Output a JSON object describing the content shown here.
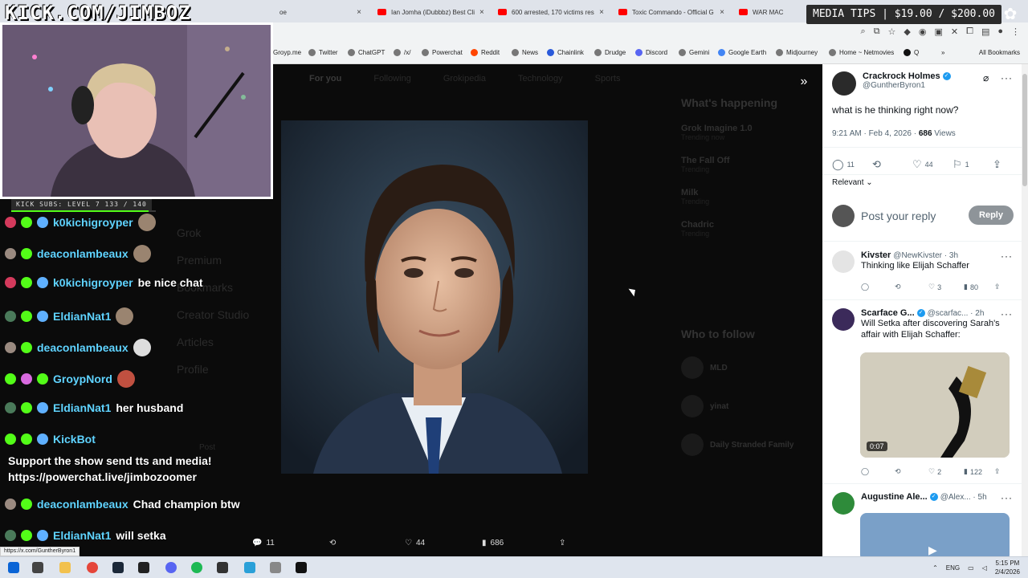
{
  "stream": {
    "channel_logo_text": "KICK.COM/JIMBOZ",
    "subs_label": "KICK SUBS: LEVEL 7 133 / 140",
    "subs_progress": 0.95,
    "media_tips": "MEDIA TIPS | $19.00 / $200.00"
  },
  "browser": {
    "tabs": [
      {
        "label": "oe"
      },
      {
        "label": "Ian Jomha (iDubbbz) Best Cli"
      },
      {
        "label": "600 arrested, 170 victims res"
      },
      {
        "label": "Toxic Commando - Official G"
      },
      {
        "label": "WAR MAC"
      }
    ],
    "bookmarks": [
      "Groyp.me",
      "Twitter",
      "ChatGPT",
      "/x/",
      "Powerchat",
      "Reddit",
      "News",
      "Chainlink",
      "Drudge",
      "Discord",
      "Gemini",
      "Google Earth",
      "Midjourney",
      "Home ~ Netmovies",
      "Q"
    ],
    "all_bookmarks": "All Bookmarks",
    "status_url": "https://x.com/GuntherByron1"
  },
  "x_page": {
    "nav_tabs": [
      "For you",
      "Following",
      "Grokipedia",
      "Technology",
      "Sports"
    ],
    "sidenav": [
      "Grok",
      "Premium",
      "Bookmarks",
      "Creator Studio",
      "Articles",
      "Profile"
    ],
    "post_button": "Post",
    "whats_happening": "What's happening",
    "trends": [
      {
        "title": "Grok Imagine 1.0",
        "sub": "Trending now"
      },
      {
        "title": "The Fall Off",
        "sub": "Trending"
      },
      {
        "title": "Milk",
        "sub": "Trending"
      },
      {
        "title": "Chadric",
        "sub": "Trending"
      }
    ],
    "who_to_follow": "Who to follow",
    "follow_suggestions": [
      "MLD",
      "yinat",
      "Daily Stranded Family"
    ]
  },
  "viewer": {
    "actions": {
      "replies": "11",
      "likes": "44",
      "views": "686"
    }
  },
  "post": {
    "name": "Crackrock Holmes",
    "handle": "@GuntherByron1",
    "text": "what is he thinking right now?",
    "time": "9:21 AM · Feb 4, 2026 · ",
    "views_count": "686",
    "views_label": " Views",
    "replies": "11",
    "likes": "44",
    "bookmarks": "1",
    "sort_label": "Relevant",
    "reply_placeholder": "Post your reply",
    "reply_button": "Reply"
  },
  "replies": [
    {
      "name": "Kivster",
      "handle": "@NewKivster · 3h",
      "text": "Thinking like Elijah Schaffer",
      "replies": "",
      "likes": "3",
      "views": "80",
      "verified": false
    },
    {
      "name": "Scarface G...",
      "handle": "@scarfac... · 2h",
      "text": "Will Setka after discovering Sarah's affair with Elijah Schaffer:",
      "replies": "",
      "likes": "2",
      "views": "122",
      "verified": true,
      "media_duration": "0:07"
    },
    {
      "name": "Augustine Ale...",
      "handle": "@Alex... · 5h",
      "text": "",
      "verified": true
    }
  ],
  "chat": [
    {
      "user": "k0kichigroyper",
      "text": "",
      "color": "#5fd3ff"
    },
    {
      "user": "deaconlambeaux",
      "text": "",
      "color": "#5fd3ff"
    },
    {
      "user": "k0kichigroyper",
      "text": "be nice chat",
      "color": "#5fd3ff"
    },
    {
      "user": "EldianNat1",
      "text": "",
      "color": "#5fd3ff"
    },
    {
      "user": "deaconlambeaux",
      "text": "",
      "color": "#5fd3ff"
    },
    {
      "user": "GroypNord",
      "text": "",
      "color": "#5fd3ff"
    },
    {
      "user": "EldianNat1",
      "text": "her husband",
      "color": "#5fd3ff"
    },
    {
      "user": "KickBot",
      "text": "",
      "color": "#5fd3ff"
    },
    {
      "user": "deaconlambeaux",
      "text": "Chad champion btw",
      "color": "#5fd3ff"
    },
    {
      "user": "EldianNat1",
      "text": "will setka",
      "color": "#5fd3ff"
    }
  ],
  "kickbot_message": "Support the show send tts and media! https://powerchat.live/jimbozoomer",
  "taskbar": {
    "lang": "ENG",
    "time": "5:15 PM",
    "date": "2/4/2026"
  },
  "colors": {
    "accent": "#1d9bf0",
    "kick_green": "#53fc18",
    "chat_user": "#5fd3ff"
  }
}
